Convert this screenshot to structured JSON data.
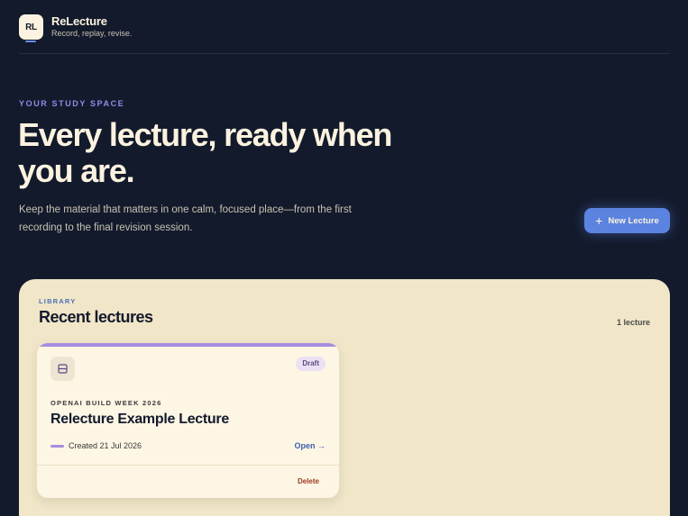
{
  "brand": {
    "logo_text": "RL",
    "name": "ReLecture",
    "tagline": "Record, replay, revise."
  },
  "hero": {
    "eyebrow": "YOUR STUDY SPACE",
    "title": "Every lecture, ready when you are.",
    "subtitle": "Keep the material that matters in one calm, focused place—from the first recording to the final revision session.",
    "new_button_label": "New Lecture",
    "new_button_icon": "plus-icon"
  },
  "library": {
    "eyebrow": "LIBRARY",
    "title": "Recent lectures",
    "count": "1 lecture",
    "lectures": [
      {
        "status": "Draft",
        "course": "OPENAI BUILD WEEK 2026",
        "title": "Relecture Example Lecture",
        "created": "Created 21 Jul 2026",
        "open_label": "Open →",
        "delete_label": "Delete",
        "icon": "document-icon"
      }
    ]
  },
  "colors": {
    "background": "#131a2c",
    "accent_blue": "#5b83e0",
    "accent_purple": "#a68de0",
    "panel": "#f1e6c8",
    "card": "#fdf6e4",
    "delete": "#9a3a24"
  }
}
